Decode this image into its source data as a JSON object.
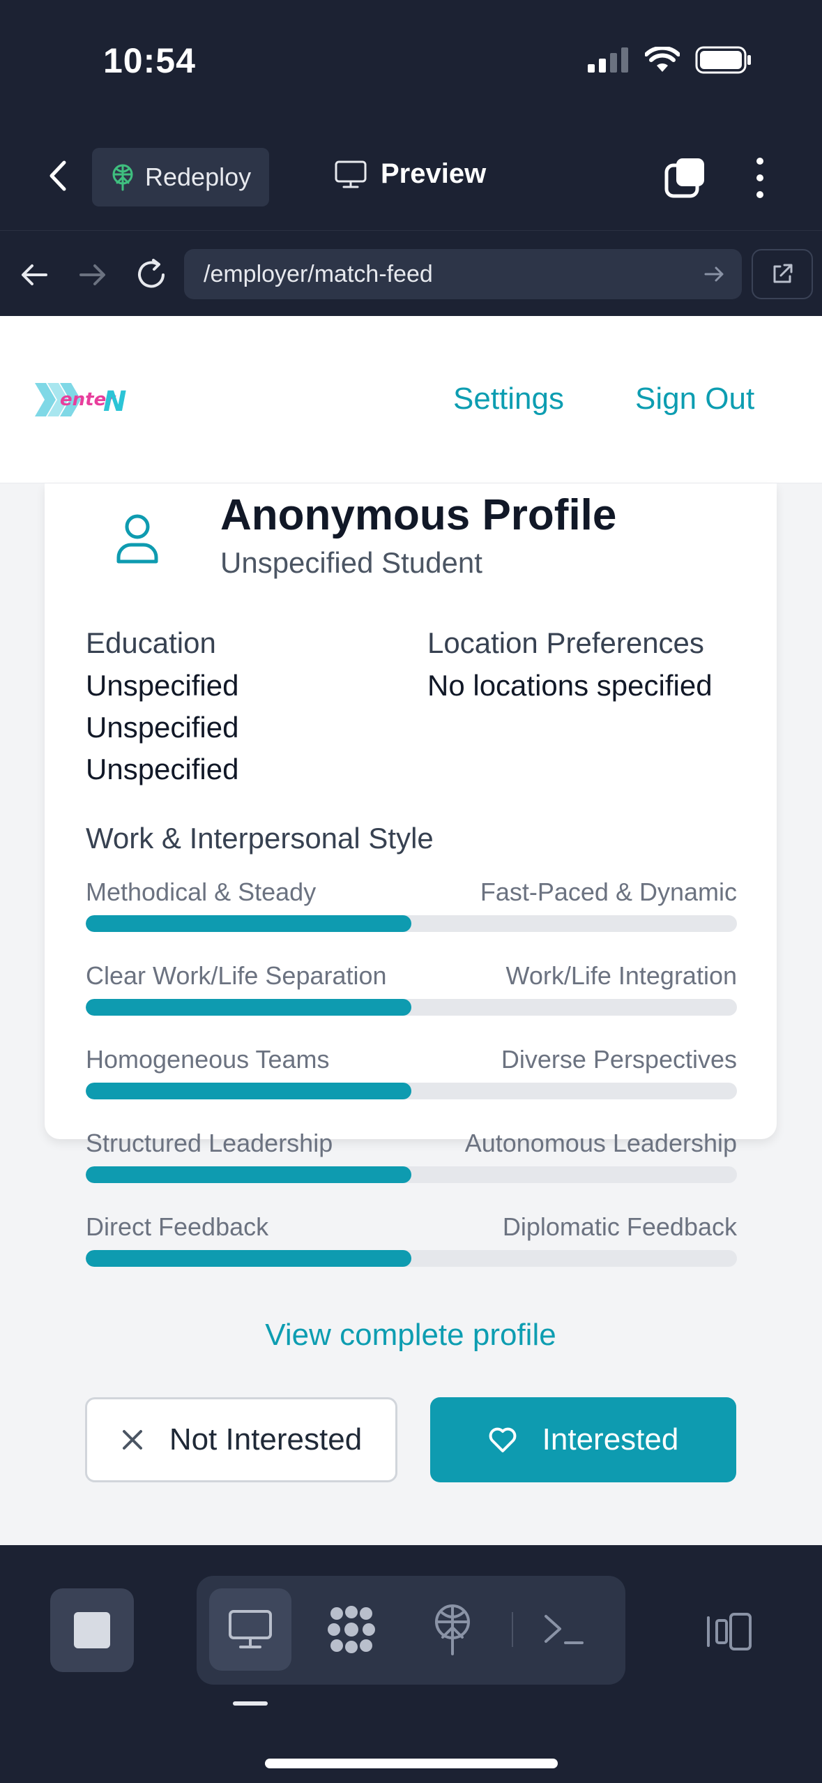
{
  "status": {
    "time": "10:54"
  },
  "toolbar": {
    "redeploy_label": "Redeploy",
    "preview_label": "Preview"
  },
  "urlbar": {
    "url": "/employer/match-feed"
  },
  "header": {
    "logo_text": "enterN",
    "settings": "Settings",
    "sign_out": "Sign Out"
  },
  "profile": {
    "title": "Anonymous Profile",
    "subtitle": "Unspecified Student",
    "education_heading": "Education",
    "education": [
      "Unspecified",
      "Unspecified",
      "Unspecified"
    ],
    "location_heading": "Location Preferences",
    "location_value": "No locations specified",
    "style_heading": "Work & Interpersonal Style",
    "sliders": [
      {
        "left": "Methodical & Steady",
        "right": "Fast-Paced & Dynamic",
        "value": 0.5
      },
      {
        "left": "Clear Work/Life Separation",
        "right": "Work/Life Integration",
        "value": 0.5
      },
      {
        "left": "Homogeneous Teams",
        "right": "Diverse Perspectives",
        "value": 0.5
      },
      {
        "left": "Structured Leadership",
        "right": "Autonomous Leadership",
        "value": 0.5
      },
      {
        "left": "Direct Feedback",
        "right": "Diplomatic Feedback",
        "value": 0.5
      }
    ],
    "view_complete": "View complete profile",
    "not_interested": "Not Interested",
    "interested": "Interested"
  },
  "colors": {
    "accent": "#0e9bb0",
    "dark_bg": "#1c2233",
    "panel": "#2d3548"
  }
}
